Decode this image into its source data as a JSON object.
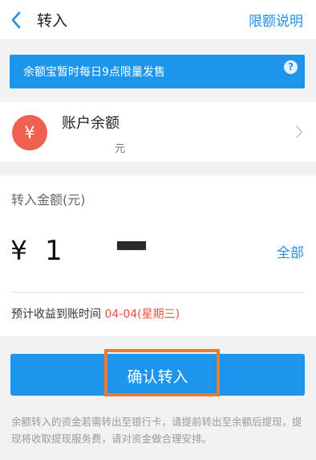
{
  "header": {
    "title": "转入",
    "right_link": "限额说明"
  },
  "notice": {
    "text": "余额宝暂时每日9点限量发售",
    "help_icon": "?"
  },
  "balance": {
    "label": "账户余额",
    "value_suffix": "元",
    "icon_symbol": "¥"
  },
  "amount": {
    "label": "转入金额(元)",
    "currency_symbol": "¥",
    "value": "1",
    "all_link": "全部"
  },
  "arrival": {
    "label": "预计收益到账时间 ",
    "date": "04-04(星期三)"
  },
  "confirm": {
    "label": "确认转入"
  },
  "footnote": {
    "text": "余额转入的资金若需转出至银行卡，请提前转出至余额后提现，提现将收取提现服务费，请对资金做合理安排。"
  },
  "colors": {
    "accent": "#1c96ec",
    "link": "#1e8fe5",
    "date_red": "#f04e3e",
    "highlight_orange": "#f0792c",
    "balance_icon": "#f0604e"
  }
}
